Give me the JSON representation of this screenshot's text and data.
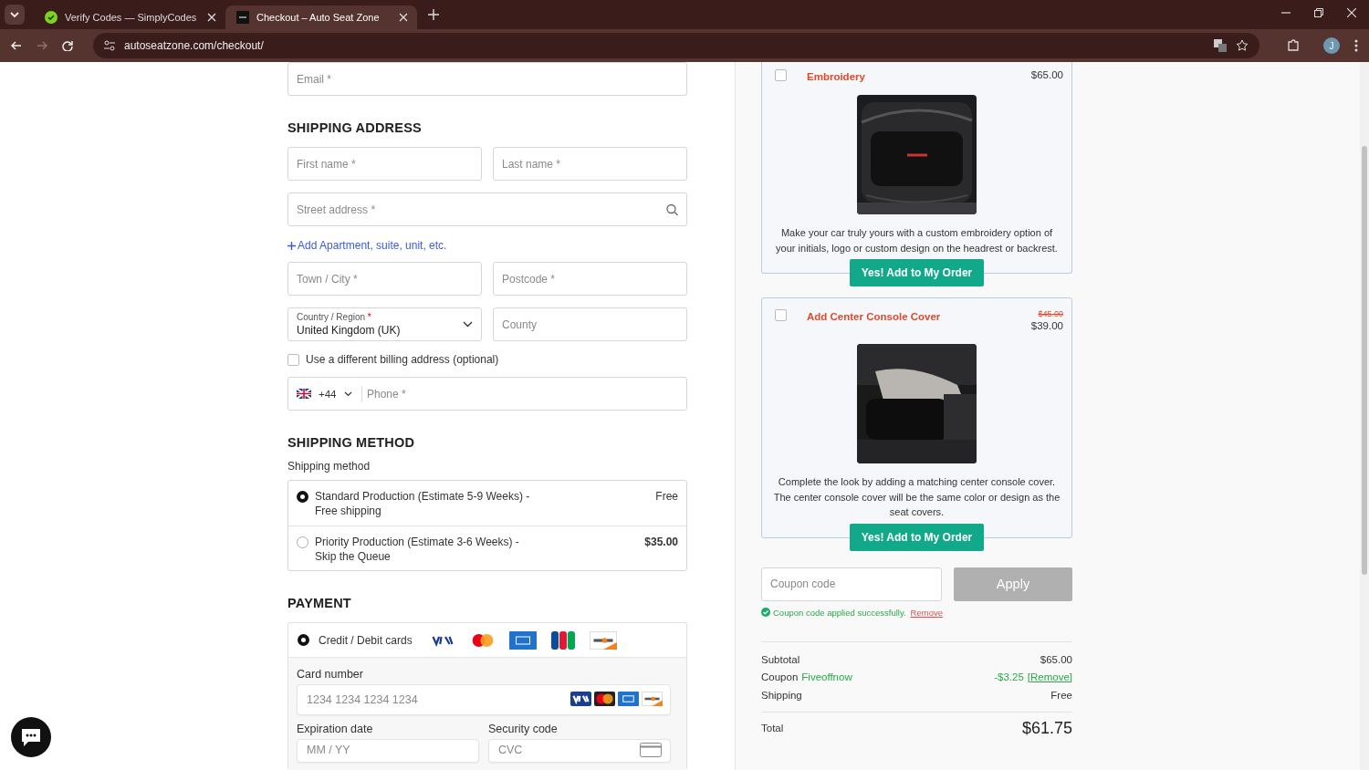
{
  "browser": {
    "tabs": [
      {
        "title": "Verify Codes — SimplyCodes",
        "selected": false
      },
      {
        "title": "Checkout – Auto Seat Zone",
        "selected": true
      }
    ],
    "url": "autoseatzone.com/checkout/",
    "profile_initial": "J"
  },
  "contact": {
    "email": {
      "placeholder": "Email *"
    }
  },
  "shipping_address": {
    "heading": "SHIPPING ADDRESS",
    "first_name": {
      "placeholder": "First name *"
    },
    "last_name": {
      "placeholder": "Last name *"
    },
    "street": {
      "placeholder": "Street address *"
    },
    "add_apartment": "Add Apartment, suite, unit, etc.",
    "town": {
      "placeholder": "Town / City *"
    },
    "postcode": {
      "placeholder": "Postcode *"
    },
    "country": {
      "label": "Country / Region",
      "required_mark": "*",
      "value": "United Kingdom (UK)"
    },
    "county": {
      "placeholder": "County"
    },
    "different_billing": {
      "label": "Use a different billing address (optional)",
      "checked": false
    },
    "phone": {
      "code": "+44",
      "placeholder": "Phone *"
    }
  },
  "shipping_method": {
    "heading": "SHIPPING METHOD",
    "label": "Shipping method",
    "options": [
      {
        "label": "Standard Production (Estimate 5-9 Weeks) - Free shipping",
        "price": "Free",
        "selected": true
      },
      {
        "label": "Priority Production (Estimate 3-6 Weeks) - Skip the Queue",
        "price": "$35.00",
        "selected": false
      }
    ]
  },
  "payment": {
    "heading": "PAYMENT",
    "method": {
      "label": "Credit / Debit cards",
      "selected": true
    },
    "card_number": {
      "label": "Card number",
      "placeholder": "1234 1234 1234 1234"
    },
    "expiration": {
      "label": "Expiration date",
      "placeholder": "MM / YY"
    },
    "security": {
      "label": "Security code",
      "placeholder": "CVC"
    }
  },
  "upsells": [
    {
      "title": "Embroidery",
      "price": "$65.00",
      "checked": false,
      "description": "Make your car truly yours with a custom embroidery option of your initials, logo or custom design on the headrest or backrest.",
      "button": "Yes! Add to My Order"
    },
    {
      "title": "Add Center Console Cover",
      "old_price": "$45.00",
      "price": "$39.00",
      "checked": false,
      "description": "Complete the look by adding a matching center console cover. The center console cover will be the same color or design as the seat covers.",
      "button": "Yes! Add to My Order"
    }
  ],
  "coupon": {
    "placeholder": "Coupon code",
    "button": "Apply",
    "disabled": true,
    "message": "Coupon code applied successfully.",
    "remove": "Remove"
  },
  "totals": {
    "subtotal": {
      "label": "Subtotal",
      "value": "$65.00"
    },
    "coupon": {
      "label": "Coupon",
      "code": "Fiveoffnow",
      "value": "-$3.25",
      "remove": "[Remove]"
    },
    "shipping": {
      "label": "Shipping",
      "value": "Free"
    },
    "total": {
      "label": "Total",
      "value": "$61.75"
    }
  }
}
